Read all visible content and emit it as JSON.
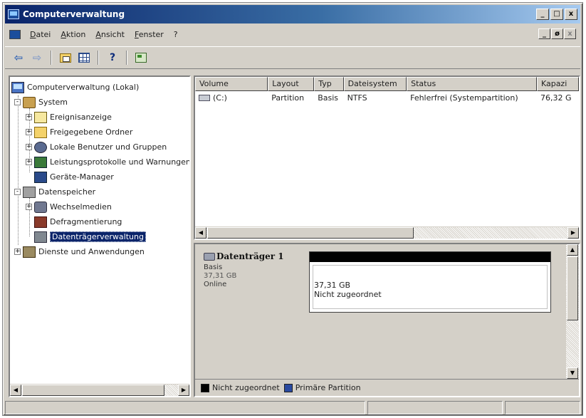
{
  "window": {
    "title": "Computerverwaltung",
    "controls": [
      "_",
      "□",
      "x"
    ]
  },
  "menu": {
    "items": [
      "Datei",
      "Aktion",
      "Ansicht",
      "Fenster",
      "?"
    ],
    "mdi_controls": [
      "_",
      "ø",
      "x"
    ]
  },
  "toolbar": {
    "back_icon": "back-arrow-icon",
    "forward_icon": "forward-arrow-icon"
  },
  "tree": {
    "root": "Computerverwaltung (Lokal)",
    "items": [
      {
        "label": "System",
        "level": 1,
        "expander": "-",
        "icon": "system-tools-icon"
      },
      {
        "label": "Ereignisanzeige",
        "level": 2,
        "expander": "+",
        "icon": "event-viewer-icon"
      },
      {
        "label": "Freigegebene Ordner",
        "level": 2,
        "expander": "+",
        "icon": "shared-folder-icon"
      },
      {
        "label": "Lokale Benutzer und Gruppen",
        "level": 2,
        "expander": "+",
        "icon": "users-icon"
      },
      {
        "label": "Leistungsprotokolle und Warnungen",
        "level": 2,
        "expander": "+",
        "icon": "performance-icon"
      },
      {
        "label": "Geräte-Manager",
        "level": 2,
        "expander": "",
        "icon": "device-manager-icon"
      },
      {
        "label": "Datenspeicher",
        "level": 1,
        "expander": "-",
        "icon": "storage-icon"
      },
      {
        "label": "Wechselmedien",
        "level": 2,
        "expander": "+",
        "icon": "removable-media-icon"
      },
      {
        "label": "Defragmentierung",
        "level": 2,
        "expander": "",
        "icon": "defrag-icon"
      },
      {
        "label": "Datenträgerverwaltung",
        "level": 2,
        "expander": "",
        "icon": "disk-management-icon",
        "selected": true
      },
      {
        "label": "Dienste und Anwendungen",
        "level": 1,
        "expander": "+",
        "icon": "services-icon"
      }
    ]
  },
  "volume_list": {
    "columns": [
      "Volume",
      "Layout",
      "Typ",
      "Dateisystem",
      "Status",
      "Kapazi"
    ],
    "rows": [
      {
        "volume": "(C:)",
        "layout": "Partition",
        "typ": "Basis",
        "dateisystem": "NTFS",
        "status": "Fehlerfrei (Systempartition)",
        "kapazitaet": "76,32 G"
      }
    ]
  },
  "disk": {
    "name": "Datenträger 1",
    "type": "Basis",
    "size": "37,31 GB",
    "state": "Online",
    "volume_size": "37,31 GB",
    "volume_state": "Nicht zugeordnet"
  },
  "legend": {
    "items": [
      {
        "label": "Nicht zugeordnet",
        "color": "#000000"
      },
      {
        "label": "Primäre Partition",
        "color": "#2a4aa0"
      }
    ]
  }
}
